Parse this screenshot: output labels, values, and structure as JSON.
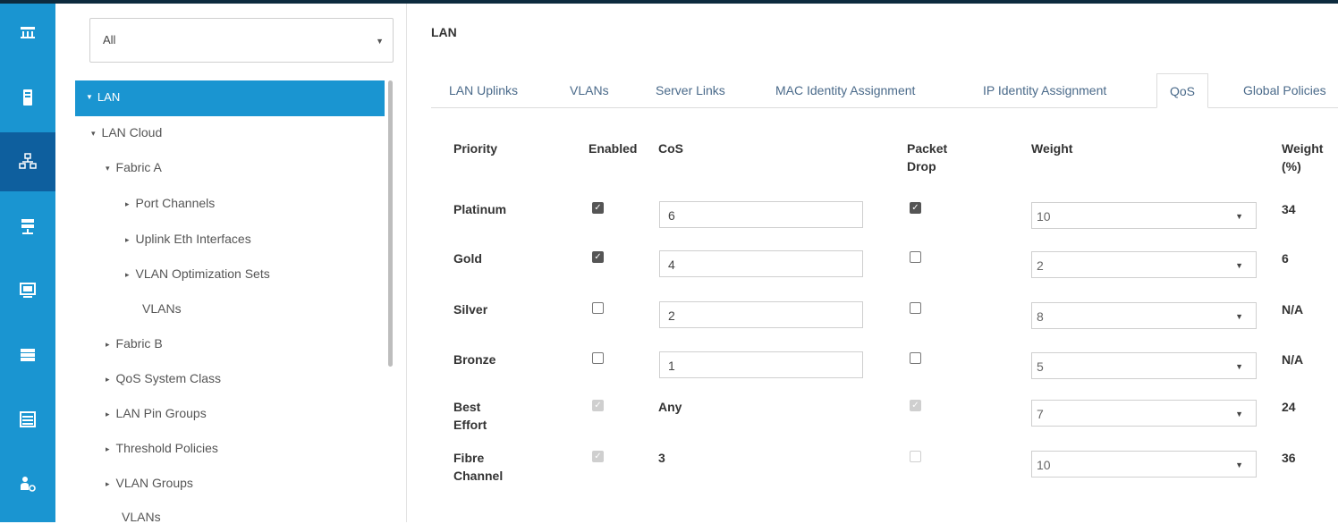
{
  "nav": {
    "filter_value": "All",
    "selected": "LAN",
    "tree": [
      {
        "label": "LAN Cloud",
        "arrow": "▾"
      },
      {
        "label": "Fabric A",
        "arrow": "▾"
      },
      {
        "label": "Port Channels",
        "arrow": "▸"
      },
      {
        "label": "Uplink Eth Interfaces",
        "arrow": "▸"
      },
      {
        "label": "VLAN Optimization Sets",
        "arrow": "▸"
      },
      {
        "label": "VLANs",
        "arrow": ""
      },
      {
        "label": "Fabric B",
        "arrow": "▸"
      },
      {
        "label": "QoS System Class",
        "arrow": "▸"
      },
      {
        "label": "LAN Pin Groups",
        "arrow": "▸"
      },
      {
        "label": "Threshold Policies",
        "arrow": "▸"
      },
      {
        "label": "VLAN Groups",
        "arrow": "▸"
      },
      {
        "label": "VLANs",
        "arrow": ""
      }
    ]
  },
  "content": {
    "title": "LAN",
    "tabs": [
      "LAN Uplinks",
      "VLANs",
      "Server Links",
      "MAC Identity Assignment",
      "IP Identity Assignment",
      "QoS",
      "Global Policies"
    ],
    "active_tab": "QoS",
    "headers": {
      "priority": "Priority",
      "enabled": "Enabled",
      "cos": "CoS",
      "packet_drop": "Packet Drop",
      "weight": "Weight",
      "weight_pct": "Weight (%)"
    },
    "rows": [
      {
        "priority": "Platinum",
        "enabled": true,
        "cos": "6",
        "packet_drop": true,
        "weight": "10",
        "weight_pct": "34"
      },
      {
        "priority": "Gold",
        "enabled": true,
        "cos": "4",
        "packet_drop": false,
        "weight": "2",
        "weight_pct": "6"
      },
      {
        "priority": "Silver",
        "enabled": false,
        "cos": "2",
        "packet_drop": false,
        "weight": "8",
        "weight_pct": "N/A"
      },
      {
        "priority": "Bronze",
        "enabled": false,
        "cos": "1",
        "packet_drop": false,
        "weight": "5",
        "weight_pct": "N/A"
      },
      {
        "priority": "Best Effort",
        "enabled": true,
        "cos": "Any",
        "packet_drop": true,
        "weight": "7",
        "weight_pct": "24"
      },
      {
        "priority": "Fibre Channel",
        "enabled": true,
        "cos": "3",
        "packet_drop": false,
        "weight": "10",
        "weight_pct": "36"
      }
    ]
  },
  "icons": [
    "equipment-icon",
    "servers-icon",
    "lan-icon",
    "san-icon",
    "vm-icon",
    "storage-icon",
    "chassis-icon",
    "admin-icon"
  ],
  "colors": {
    "accent": "#1a95d1",
    "rail_active": "#0e5f9e"
  }
}
